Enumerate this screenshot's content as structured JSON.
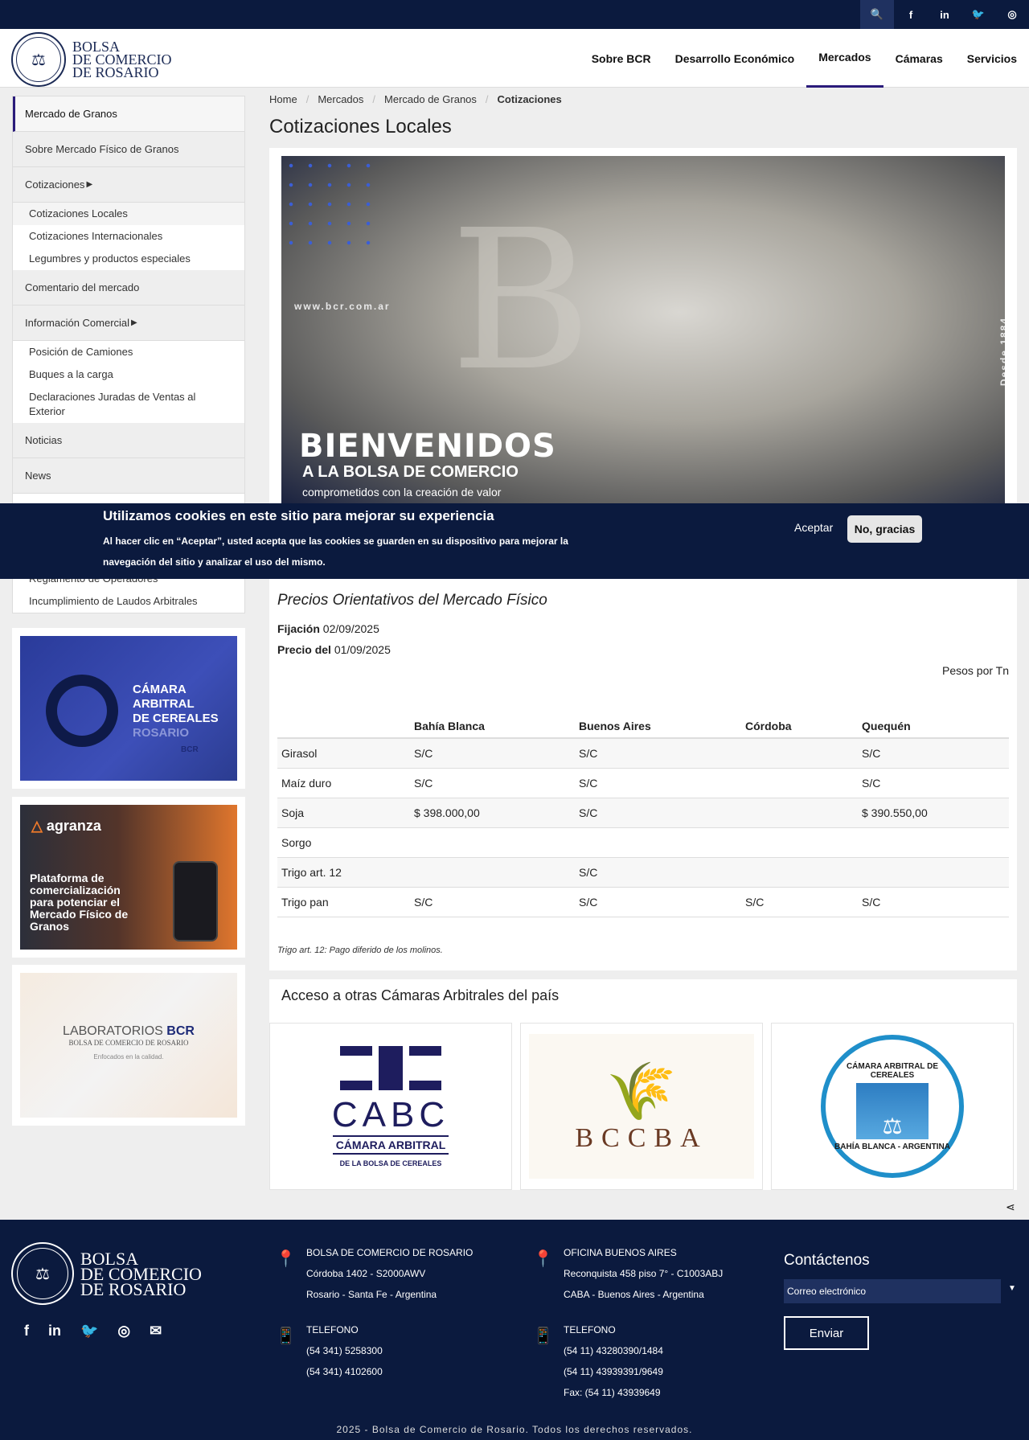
{
  "topbar": {
    "icons": [
      "search-icon",
      "facebook-icon",
      "linkedin-icon",
      "twitter-icon",
      "instagram-icon"
    ],
    "glyphs": [
      "🔍",
      "f",
      "in",
      "🐦",
      "◎"
    ]
  },
  "logo": {
    "line1": "BOLSA",
    "line2": "DE COMERCIO",
    "line3": "DE ROSARIO"
  },
  "nav": [
    {
      "label": "Sobre BCR",
      "active": false
    },
    {
      "label": "Desarrollo Económico",
      "active": false
    },
    {
      "label": "Mercados",
      "active": true
    },
    {
      "label": "Cámaras",
      "active": false
    },
    {
      "label": "Servicios",
      "active": false
    }
  ],
  "sidebar": {
    "main": "Mercado de Granos",
    "sobre": "Sobre Mercado Físico de Granos",
    "cotizaciones": "Cotizaciones",
    "cot_items": [
      "Cotizaciones Locales",
      "Cotizaciones Internacionales",
      "Legumbres y productos especiales"
    ],
    "comentario": "Comentario del mercado",
    "info": "Información Comercial",
    "info_items": [
      "Posición de Camiones",
      "Buques a la carga",
      "Declaraciones Juradas de Ventas al Exterior"
    ],
    "noticias": "Noticias",
    "news": "News",
    "lower_items": [
      "Reglamento de Operadores",
      "Incumplimiento de Laudos Arbitrales"
    ]
  },
  "banners": {
    "camara": {
      "l1": "CÁMARA",
      "l2": "ARBITRAL",
      "l3": "DE CEREALES",
      "l4": "ROSARIO",
      "l5": "BCR"
    },
    "agranza": {
      "brand": "agranza",
      "text": "Plataforma de comercialización para potenciar el Mercado Físico de Granos"
    },
    "lab": {
      "l1": "LABORATORIOS",
      "l1b": "BCR",
      "l2": "BOLSA DE COMERCIO DE ROSARIO",
      "l3": "Enfocados en la calidad."
    }
  },
  "breadcrumb": [
    "Home",
    "Mercados",
    "Mercado de Granos",
    "Cotizaciones"
  ],
  "page_title": "Cotizaciones Locales",
  "hero": {
    "url": "www.bcr.com.ar",
    "since": "Desde 1884",
    "h1": "BIENVENIDOS",
    "h2": "A LA BOLSA DE COMERCIO",
    "h3": "comprometidos con la creación de valor"
  },
  "cookie": {
    "title": "Utilizamos cookies en este sitio para mejorar su experiencia",
    "desc": "Al hacer clic en “Aceptar”, usted acepta que las cookies se guarden en su dispositivo para mejorar la navegación del sitio y analizar el uso del mismo.",
    "accept": "Aceptar",
    "decline": "No, gracias"
  },
  "prices": {
    "title": "Precios Orientativos del Mercado Físico",
    "fijacion_label": "Fijación",
    "fijacion": "02/09/2025",
    "precio_label": "Precio del",
    "precio": "01/09/2025",
    "units": "Pesos por Tn",
    "columns": [
      "",
      "Bahía Blanca",
      "Buenos Aires",
      "Córdoba",
      "Quequén"
    ],
    "rows": [
      [
        "Girasol",
        "S/C",
        "S/C",
        "",
        "S/C"
      ],
      [
        "Maíz duro",
        "S/C",
        "S/C",
        "",
        "S/C"
      ],
      [
        "Soja",
        "$ 398.000,00",
        "S/C",
        "",
        "$ 390.550,00"
      ],
      [
        "Sorgo",
        "",
        "",
        "",
        ""
      ],
      [
        "Trigo art. 12",
        "",
        "S/C",
        "",
        ""
      ],
      [
        "Trigo pan",
        "S/C",
        "S/C",
        "S/C",
        "S/C"
      ]
    ],
    "note": "Trigo art. 12: Pago diferido de los molinos."
  },
  "arbitral": {
    "title": "Acceso a otras Cámaras Arbitrales del país",
    "cabc": {
      "name": "CABC",
      "l1": "CÁMARA ARBITRAL",
      "l2": "DE LA BOLSA DE CEREALES"
    },
    "bccba": "BCCBA",
    "cabb": {
      "top": "CÁMARA ARBITRAL DE CEREALES",
      "bottom": "BAHÍA BLANCA - ARGENTINA"
    }
  },
  "footer": {
    "logo": {
      "line1": "BOLSA",
      "line2": "DE COMERCIO",
      "line3": "DE ROSARIO"
    },
    "social": [
      "facebook-icon",
      "linkedin-icon",
      "twitter-icon",
      "instagram-icon",
      "email-icon"
    ],
    "social_glyphs": [
      "f",
      "in",
      "🐦",
      "◎",
      "✉"
    ],
    "rosario": {
      "title": "BOLSA DE COMERCIO DE ROSARIO",
      "l1": "Córdoba 1402 - S2000AWV",
      "l2": "Rosario - Santa Fe - Argentina"
    },
    "bsas": {
      "title": "OFICINA BUENOS AIRES",
      "l1": "Reconquista 458 piso 7° - C1003ABJ",
      "l2": "CABA - Buenos Aires - Argentina"
    },
    "tel1": {
      "title": "TELEFONO",
      "l1": "(54 341) 5258300",
      "l2": "(54 341) 4102600"
    },
    "tel2": {
      "title": "TELEFONO",
      "l1": "(54 11) 43280390/1484",
      "l2": "(54 11) 43939391/9649",
      "l3": "Fax: (54 11) 43939649"
    },
    "contact_title": "Contáctenos",
    "email_value": "Correo electrónico",
    "send": "Enviar",
    "copyright": "2025 - Bolsa de Comercio de Rosario. Todos los derechos reservados."
  },
  "colors": {
    "navy": "#0b1a3e",
    "accent": "#2a1b7a"
  }
}
